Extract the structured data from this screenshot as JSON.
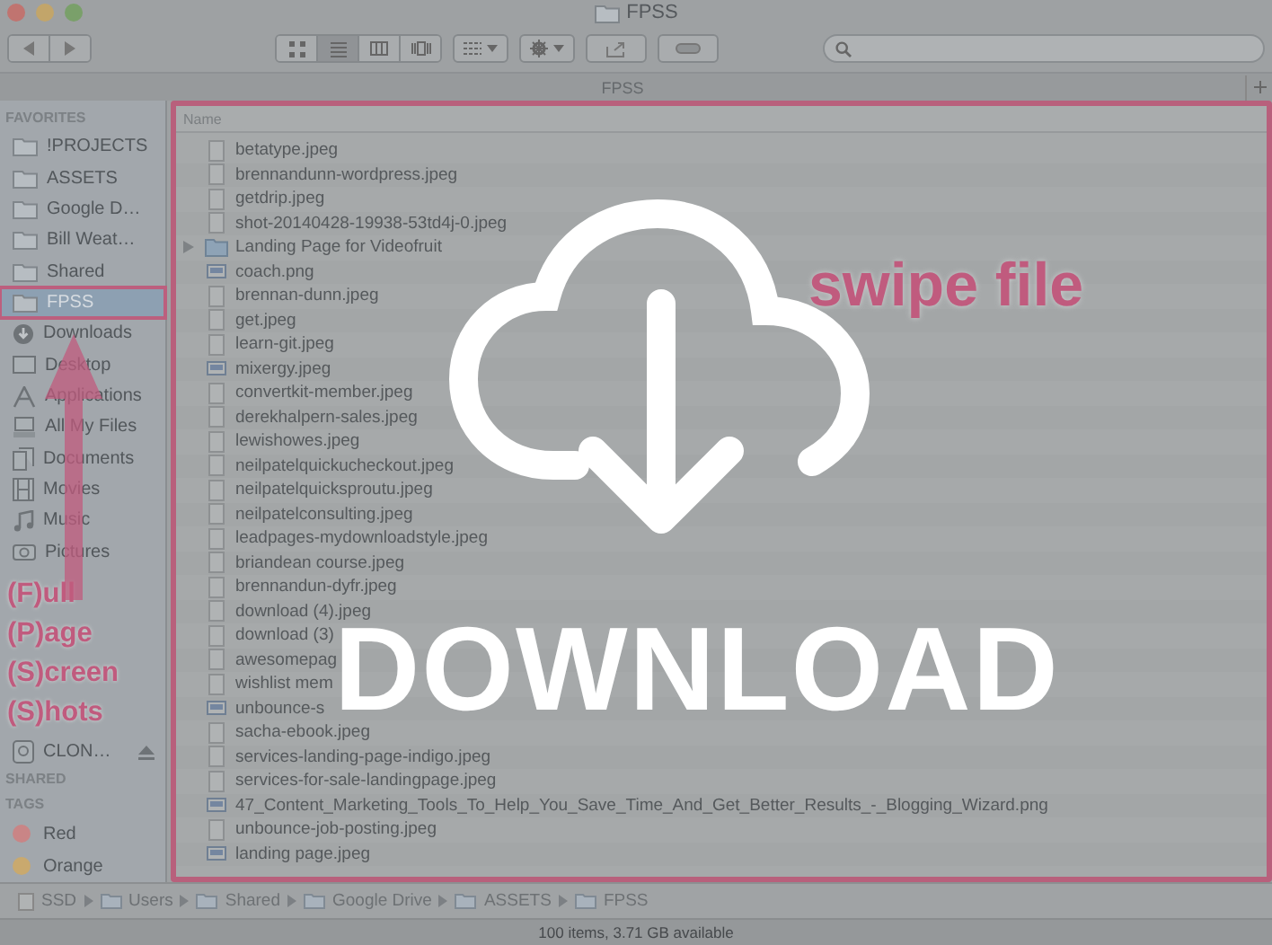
{
  "window": {
    "title": "FPSS"
  },
  "toolbar": {
    "views": [
      {
        "kind": "icons",
        "selected": false
      },
      {
        "kind": "list",
        "selected": true
      },
      {
        "kind": "columns",
        "selected": false
      },
      {
        "kind": "coverflow",
        "selected": false
      }
    ]
  },
  "tab": {
    "label": "FPSS"
  },
  "sidebar": {
    "sections": [
      {
        "header": "FAVORITES",
        "items": [
          {
            "label": "!PROJECTS",
            "kind": "folder",
            "selected": false,
            "highlight": false
          },
          {
            "label": "ASSETS",
            "kind": "folder",
            "selected": false,
            "highlight": false
          },
          {
            "label": "Google D…",
            "kind": "folder",
            "selected": false,
            "highlight": false
          },
          {
            "label": "Bill Weat…",
            "kind": "folder",
            "selected": false,
            "highlight": false
          },
          {
            "label": "Shared",
            "kind": "folder",
            "selected": false,
            "highlight": false
          },
          {
            "label": "FPSS",
            "kind": "folder",
            "selected": true,
            "highlight": true
          },
          {
            "label": "Downloads",
            "kind": "download",
            "selected": false,
            "highlight": false
          },
          {
            "label": "Desktop",
            "kind": "desktop",
            "selected": false,
            "highlight": false
          },
          {
            "label": "Applications",
            "kind": "apps",
            "selected": false,
            "highlight": false
          },
          {
            "label": "All My Files",
            "kind": "files",
            "selected": false,
            "highlight": false
          },
          {
            "label": "Documents",
            "kind": "docs",
            "selected": false,
            "highlight": false
          },
          {
            "label": "Movies",
            "kind": "movies",
            "selected": false,
            "highlight": false
          },
          {
            "label": "Music",
            "kind": "music",
            "selected": false,
            "highlight": false
          },
          {
            "label": "Pictures",
            "kind": "pictures",
            "selected": false,
            "highlight": false
          }
        ]
      },
      {
        "annotation": [
          "(F)ull",
          "(P)age",
          "(S)creen",
          "(S)hots"
        ],
        "items": [
          {
            "label": "CLON…",
            "kind": "disk",
            "selected": false,
            "highlight": false
          }
        ]
      },
      {
        "header": "SHARED"
      },
      {
        "header": "TAGS",
        "tags": [
          {
            "label": "Red",
            "color": "#c98586"
          },
          {
            "label": "Orange",
            "color": "#c9a96e"
          }
        ]
      }
    ]
  },
  "file_list": {
    "column": "Name",
    "rows": [
      {
        "name": "betatype.jpeg",
        "kind": "file"
      },
      {
        "name": "brennandunn-wordpress.jpeg",
        "kind": "file"
      },
      {
        "name": "getdrip.jpeg",
        "kind": "file"
      },
      {
        "name": "shot-20140428-19938-53td4j-0.jpeg",
        "kind": "file"
      },
      {
        "name": "Landing Page for Videofruit",
        "kind": "folder"
      },
      {
        "name": "coach.png",
        "kind": "image"
      },
      {
        "name": "brennan-dunn.jpeg",
        "kind": "file"
      },
      {
        "name": "get.jpeg",
        "kind": "file"
      },
      {
        "name": "learn-git.jpeg",
        "kind": "file"
      },
      {
        "name": "mixergy.jpeg",
        "kind": "image"
      },
      {
        "name": "convertkit-member.jpeg",
        "kind": "file"
      },
      {
        "name": "derekhalpern-sales.jpeg",
        "kind": "file"
      },
      {
        "name": "lewishowes.jpeg",
        "kind": "file"
      },
      {
        "name": "neilpatelquickucheckout.jpeg",
        "kind": "file"
      },
      {
        "name": "neilpatelquicksproutu.jpeg",
        "kind": "file"
      },
      {
        "name": "neilpatelconsulting.jpeg",
        "kind": "file"
      },
      {
        "name": "leadpages-mydownloadstyle.jpeg",
        "kind": "file"
      },
      {
        "name": "briandean course.jpeg",
        "kind": "file"
      },
      {
        "name": "brennandun-dyfr.jpeg",
        "kind": "file"
      },
      {
        "name": "download (4).jpeg",
        "kind": "file"
      },
      {
        "name": "download (3)",
        "kind": "file"
      },
      {
        "name": "awesomepag",
        "kind": "file"
      },
      {
        "name": "wishlist mem",
        "kind": "file"
      },
      {
        "name": "unbounce-s",
        "kind": "image"
      },
      {
        "name": "sacha-ebook.jpeg",
        "kind": "file"
      },
      {
        "name": "services-landing-page-indigo.jpeg",
        "kind": "file"
      },
      {
        "name": "services-for-sale-landingpage.jpeg",
        "kind": "file"
      },
      {
        "name": "47_Content_Marketing_Tools_To_Help_You_Save_Time_And_Get_Better_Results_-_Blogging_Wizard.png",
        "kind": "image"
      },
      {
        "name": "unbounce-job-posting.jpeg",
        "kind": "file"
      },
      {
        "name": "landing page.jpeg",
        "kind": "image"
      }
    ]
  },
  "callout": "swipe file",
  "overlay": {
    "label": "DOWNLOAD"
  },
  "path_bar": [
    {
      "label": "SSD",
      "kind": "disk"
    },
    {
      "label": "Users",
      "kind": "folder"
    },
    {
      "label": "Shared",
      "kind": "folder"
    },
    {
      "label": "Google Drive",
      "kind": "folder"
    },
    {
      "label": "ASSETS",
      "kind": "folder"
    },
    {
      "label": "FPSS",
      "kind": "folder"
    }
  ],
  "status_bar": "100 items, 3.71 GB available"
}
